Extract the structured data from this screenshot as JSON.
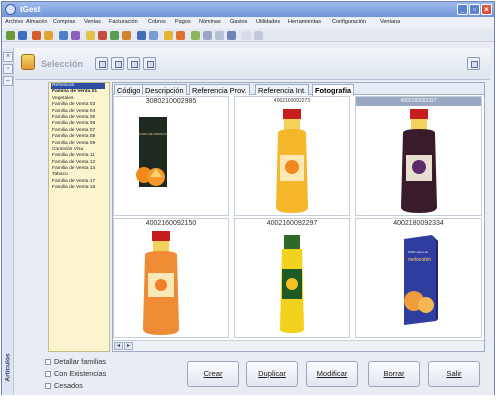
{
  "window": {
    "title": "tGest"
  },
  "menu": [
    "Archivo",
    "Almacén",
    "Compras",
    "Ventas",
    "Facturación",
    "Cobros",
    "Pagos",
    "Nóminas",
    "Gastos",
    "Utilidades",
    "Herramientas",
    "Configuración",
    "Ventana"
  ],
  "selection": {
    "title": "Selección"
  },
  "families": [
    "Refrescos",
    "Familia de Venta 01",
    "Vegetales",
    "Familia de Venta 03",
    "Familia de Venta 04",
    "Familia de Venta 05",
    "Familia de Venta 06",
    "Familia de Venta 07",
    "Familia de Venta 08",
    "Familia de Venta 09",
    "Comisión Visa",
    "Familia de Venta 11",
    "Familia de Venta 12",
    "Familia de Venta 13",
    "Tabaco",
    "Familia de Venta 17",
    "Familia de Venta 18"
  ],
  "tabs": [
    "Código",
    "Descripción",
    "Referencia Prov.",
    "Referencia Int.",
    "Fotografía"
  ],
  "products": [
    {
      "code": "3080210002985",
      "image_label_1": "ZUMO DE NARANJA"
    },
    {
      "code": "4002160092273"
    },
    {
      "code": "4002160092327"
    },
    {
      "code": "4002160092150"
    },
    {
      "code": "4002160092297"
    },
    {
      "code": "4002180092334",
      "image_label_1": "100% zumo de",
      "image_label_2": "melocotón"
    }
  ],
  "options": {
    "detallar": "Detallar familias",
    "existencias": "Con Existencias",
    "cesados": "Cesados"
  },
  "buttons": {
    "crear": "Crear",
    "duplicar": "Duplicar",
    "modificar": "Modificar",
    "borrar": "Borrar",
    "salir": "Salir"
  },
  "rail": {
    "label": "Artículos"
  },
  "colors": {
    "title_bar": "#6f95d8",
    "list_background": "#fbf5cf",
    "selected_row": "#2c4fa3"
  }
}
